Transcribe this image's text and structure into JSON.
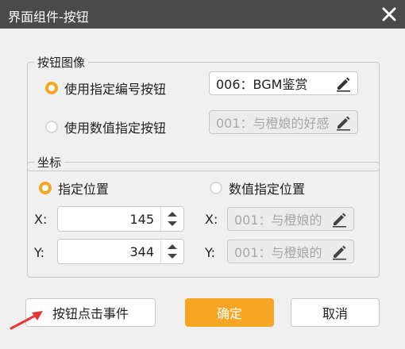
{
  "window": {
    "title": "界面组件-按钮",
    "close_icon": "close-icon"
  },
  "button_image": {
    "legend": "按钮图像",
    "option_specified_number": {
      "label": "使用指定编号按钮",
      "selected": true,
      "value": "006：BGM鉴赏"
    },
    "option_numeric": {
      "label": "使用数值指定按钮",
      "selected": false,
      "value": "001：与橙娘的好感"
    }
  },
  "coordinates": {
    "legend": "坐标",
    "option_specified_position": {
      "label": "指定位置",
      "selected": true
    },
    "option_numeric_position": {
      "label": "数值指定位置",
      "selected": false
    },
    "x_label": "X:",
    "y_label": "Y:",
    "x_value": "145",
    "y_value": "344",
    "x_variable": "001：与橙娘的",
    "y_variable": "001：与橙娘的"
  },
  "buttons": {
    "click_event": "按钮点击事件",
    "ok": "确定",
    "cancel": "取消"
  },
  "colors": {
    "titlebar": "#4a4a4a",
    "accent": "#f5a623",
    "arrow": "#e53935"
  }
}
